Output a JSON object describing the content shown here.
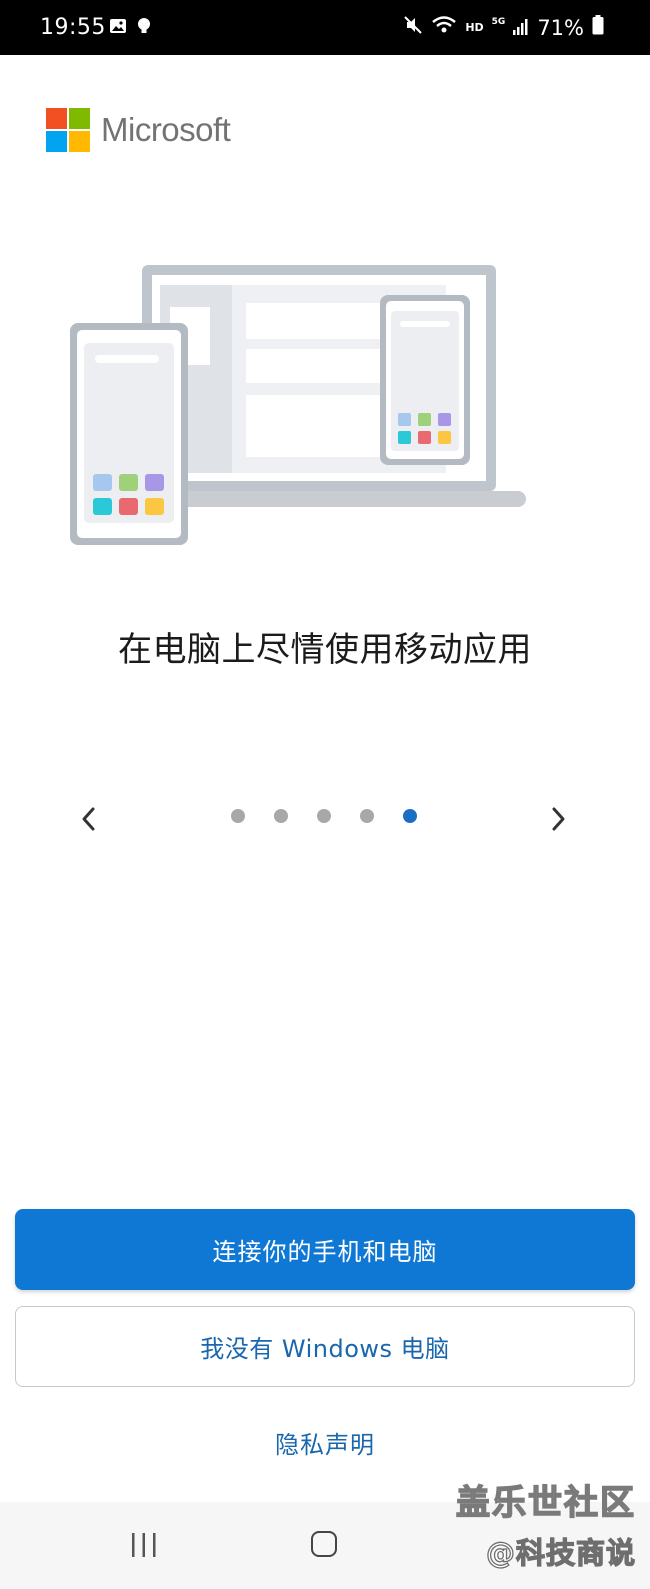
{
  "status_bar": {
    "time": "19:55",
    "hd": "HD",
    "network": "5G",
    "battery": "71%"
  },
  "brand": {
    "name": "Microsoft",
    "colors": [
      "#f25022",
      "#7fba00",
      "#00a4ef",
      "#ffb900"
    ]
  },
  "onboarding": {
    "headline": "在电脑上尽情使用移动应用",
    "pager": {
      "total": 5,
      "current": 5
    }
  },
  "actions": {
    "connect_label": "连接你的手机和电脑",
    "no_windows_label": "我没有 Windows 电脑",
    "privacy_label": "隐私声明"
  },
  "watermark": {
    "line1": "盖乐世社区",
    "line2": "@科技商说"
  },
  "colors": {
    "accent": "#0f78d4",
    "link": "#1a67ad",
    "dot_active": "#1a6fc4",
    "dot_inactive": "#a8a8a8"
  }
}
